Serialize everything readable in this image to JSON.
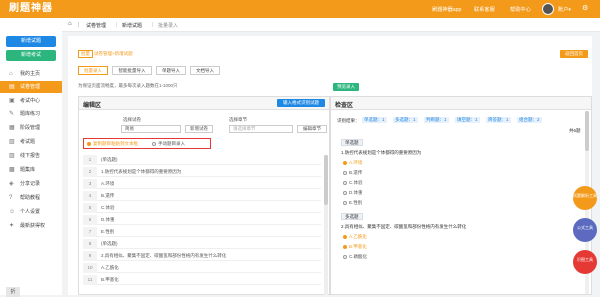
{
  "app": {
    "logo": "刷题神器",
    "user": "账户▾"
  },
  "topbar": {
    "links": [
      "刷题神器app",
      "联系客服",
      "帮助中心"
    ]
  },
  "sidebar": {
    "primary_btn": "新增试题",
    "secondary_btn": "新增考试",
    "items": [
      {
        "label": "我的主页",
        "icon": "⌂"
      },
      {
        "label": "试卷管理",
        "icon": "▤"
      },
      {
        "label": "考试中心",
        "icon": "▣"
      },
      {
        "label": "题库练习",
        "icon": "✎"
      },
      {
        "label": "阶段管理",
        "icon": "▦"
      },
      {
        "label": "考试题",
        "icon": "▧"
      },
      {
        "label": "线下报告",
        "icon": "▨"
      },
      {
        "label": "题集库",
        "icon": "▩"
      },
      {
        "label": "分享记录",
        "icon": "◈"
      },
      {
        "label": "帮助教程",
        "icon": "?"
      },
      {
        "label": "个人设置",
        "icon": "☺"
      },
      {
        "label": "最新获得权",
        "icon": "✦"
      }
    ],
    "collapse": "折"
  },
  "breadcrumb": {
    "home": "⌂",
    "items": [
      "试卷管理",
      "新增试题",
      "批量录入"
    ]
  },
  "main": {
    "tag_small": "批量",
    "tag_text": "试卷管理>新增试题",
    "back_btn": "返回首页",
    "tabs": [
      "批量录入",
      "智能批量导入",
      "单题导入",
      "文档导入"
    ],
    "hint": "为保证页面流畅度，最多每次录入题数在1-1000只"
  },
  "editor": {
    "title": "编辑区",
    "import_btn": "输入格式识别试题",
    "type_label": "选择试卷",
    "type_value": "简易",
    "new_btn": "新增试卷",
    "chapter_label": "选择章节",
    "chapter_value": "请选择章节",
    "edit_chapter": "编辑章节",
    "mode_a": "复制题目粘贴到文本框",
    "mode_b": "手动题目录入",
    "lines": [
      {
        "no": "1",
        "text": "(单选题)"
      },
      {
        "no": "2",
        "text": "1.防控代表规划是个体都得的重要原因为"
      },
      {
        "no": "3",
        "text": "A.环境"
      },
      {
        "no": "4",
        "text": "B.遗传"
      },
      {
        "no": "5",
        "text": "C.体验"
      },
      {
        "no": "6",
        "text": "D.体重"
      },
      {
        "no": "7",
        "text": "E.性别"
      },
      {
        "no": "8",
        "text": "(单选题)"
      },
      {
        "no": "9",
        "text": "2.具有相似、聚集不固定、碳酸氢和部份性格内有发生什么转化"
      },
      {
        "no": "10",
        "text": "A.乙酰化"
      },
      {
        "no": "11",
        "text": "B.甲基化"
      }
    ]
  },
  "checker": {
    "title": "检查区",
    "preview_btn": "预览录入",
    "summary_label": "识别结果：",
    "counts": [
      "单选题：1",
      "多选题：1",
      "判断题：1",
      "填空题：1",
      "简答题：1",
      "组合题：2"
    ],
    "total": "共6题",
    "q1_label": "单选题",
    "q1_text": "1.防控代表规划是个体都得的重要原因为",
    "q1_opts": [
      "A.环境",
      "B.遗传",
      "C.体验",
      "D.体重",
      "E.性别"
    ],
    "q2_label": "多选题",
    "q2_text": "2.具有相似、聚集不固定、碳酸氢和部份性格内有发生什么转化",
    "q2_opts": [
      "A.乙酰化",
      "B.甲基化",
      "C.磷酸化"
    ]
  },
  "fabs": [
    "试题解析工具",
    "公式工具",
    "识图工具"
  ],
  "colors": {
    "accent": "#f39a1a",
    "blue": "#1e88e5"
  }
}
